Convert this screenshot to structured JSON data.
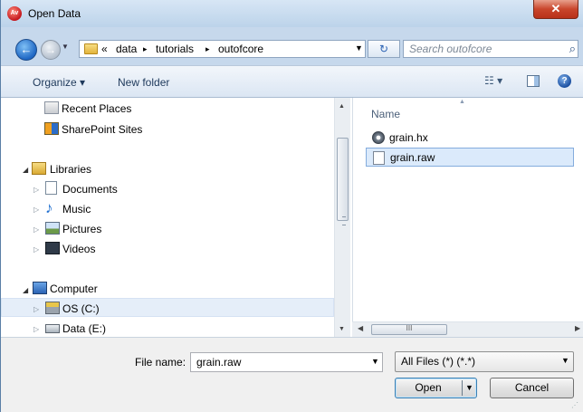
{
  "window": {
    "title": "Open Data",
    "app_icon": "Av",
    "close_glyph": "✕"
  },
  "address": {
    "overflow": "«",
    "separator": "▸",
    "crumbs": [
      "data",
      "tutorials",
      "outofcore"
    ],
    "search_placeholder": "Search outofcore"
  },
  "toolbar": {
    "organize_label": "Organize ▾",
    "new_folder_label": "New folder",
    "view_label": "☷ ▾",
    "help_label": "?"
  },
  "nav": {
    "items": [
      {
        "label": "Recent Places",
        "icon": "recent-places-icon"
      },
      {
        "label": "SharePoint Sites",
        "icon": "sharepoint-icon"
      },
      {
        "label": "Libraries",
        "icon": "libraries-icon"
      },
      {
        "label": "Documents",
        "icon": "documents-icon"
      },
      {
        "label": "Music",
        "icon": "music-icon"
      },
      {
        "label": "Pictures",
        "icon": "pictures-icon"
      },
      {
        "label": "Videos",
        "icon": "videos-icon"
      },
      {
        "label": "Computer",
        "icon": "computer-icon"
      },
      {
        "label": "OS (C:)",
        "icon": "drive-c-icon"
      },
      {
        "label": "Data (E:)",
        "icon": "drive-e-icon"
      }
    ],
    "selected": "OS (C:)"
  },
  "files": {
    "column_name": "Name",
    "items": [
      {
        "name": "grain.hx",
        "icon": "hx-file-icon",
        "selected": false
      },
      {
        "name": "grain.raw",
        "icon": "blank-file-icon",
        "selected": true
      }
    ]
  },
  "hscroll_thumb": "III",
  "bottom": {
    "file_name_label": "File name:",
    "file_name_value": "grain.raw",
    "file_type_value": "All Files (*) (*.*)",
    "open_label": "Open",
    "cancel_label": "Cancel"
  },
  "colors": {
    "selection_fill": "#dbeafb",
    "selection_border": "#84acdd",
    "link_text": "#1e395b"
  }
}
